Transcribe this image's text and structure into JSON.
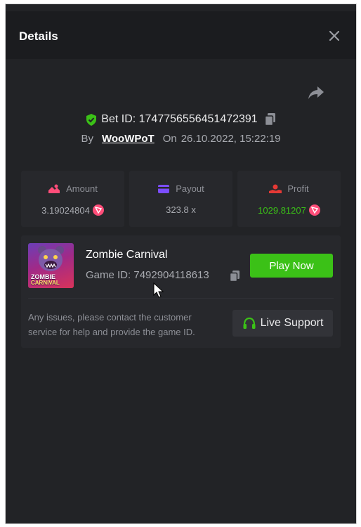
{
  "header": {
    "title": "Details"
  },
  "bet": {
    "id_label": "Bet ID: 1747756556451472391",
    "by_label": "By",
    "user": "WooWPoT",
    "on_label": "On",
    "datetime": "26.10.2022, 15:22:19"
  },
  "stats": {
    "amount": {
      "label": "Amount",
      "value": "3.19024804"
    },
    "payout": {
      "label": "Payout",
      "value": "323.8 x"
    },
    "profit": {
      "label": "Profit",
      "value": "1029.81207"
    }
  },
  "game": {
    "name": "Zombie Carnival",
    "id_label": "Game ID: 7492904118613",
    "thumb_line1": "ZOMBIE",
    "thumb_line2": "CARNIVAL",
    "play_label": "Play Now"
  },
  "support": {
    "message": "Any issues, please contact the customer service for help and provide the game ID.",
    "button_label": "Live Support"
  },
  "icons": {
    "verified": "shield-check-icon",
    "copy": "copy-icon",
    "share": "share-icon",
    "close": "close-icon",
    "amount": "amount-icon",
    "payout": "card-icon",
    "profit": "profit-icon",
    "currency": "tron-icon",
    "headset": "headset-icon"
  },
  "colors": {
    "accent_green": "#3bc117",
    "currency_pink": "#ff4d79",
    "amount_icon": "#ff4d79",
    "payout_icon": "#7b4dff",
    "profit_icon": "#e53935"
  }
}
